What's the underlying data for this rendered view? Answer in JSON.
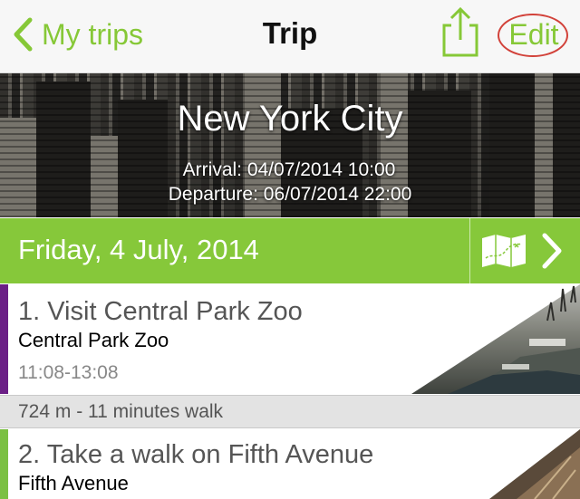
{
  "nav": {
    "back_label": "My trips",
    "title": "Trip",
    "edit_label": "Edit",
    "accent": "#86c837",
    "edit_highlight": "#d2423a"
  },
  "trip": {
    "city": "New York City",
    "arrival": "Arrival: 04/07/2014 10:00",
    "departure": "Departure: 06/07/2014 22:00"
  },
  "day": {
    "label": "Friday, 4 July, 2014",
    "color": "#86c83a"
  },
  "items": [
    {
      "title": "1. Visit Central Park Zoo",
      "place": "Central Park Zoo",
      "time": "11:08-13:08",
      "stripe_color": "#6b1f86"
    },
    {
      "title": "2. Take a walk on Fifth Avenue",
      "place": "Fifth Avenue",
      "stripe_color": "#7bc043"
    }
  ],
  "transit": {
    "label": "724 m - 11 minutes walk"
  },
  "icons": [
    "chevron-left-icon",
    "share-icon",
    "map-icon",
    "chevron-right-icon"
  ]
}
